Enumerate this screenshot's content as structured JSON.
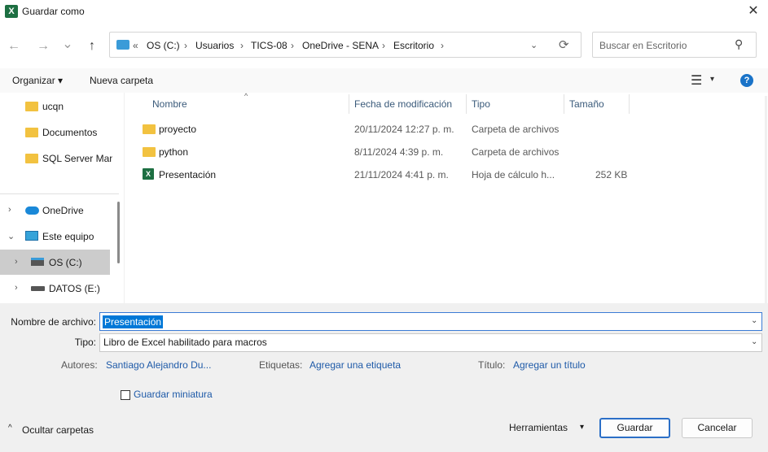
{
  "window": {
    "title": "Guardar como",
    "app_icon": "X",
    "close_glyph": "✕"
  },
  "nav": {
    "back": "←",
    "forward": "→",
    "recent": "⌄",
    "up": "↑",
    "prefix": "«",
    "breadcrumb": [
      "OS (C:)",
      "Usuarios",
      "TICS-08",
      "OneDrive - SENA",
      "Escritorio"
    ],
    "sep": "›",
    "dropdown": "⌄",
    "refresh": "⟳",
    "search_placeholder": "Buscar en Escritorio",
    "search_glyph": "⚲"
  },
  "commands": {
    "organize": "Organizar ▾",
    "new_folder": "Nueva carpeta",
    "view_glyph": "☰",
    "view_caret": "▾",
    "help": "?"
  },
  "tree": {
    "items": [
      {
        "label": "ucqn"
      },
      {
        "label": "Documentos"
      },
      {
        "label": "SQL Server Man"
      },
      {
        "label": "OneDrive"
      },
      {
        "label": "Este equipo"
      },
      {
        "label": "OS (C:)"
      },
      {
        "label": "DATOS (E:)"
      }
    ]
  },
  "columns": {
    "name": "Nombre",
    "modified": "Fecha de modificación",
    "type": "Tipo",
    "size": "Tamaño",
    "sort_glyph": "^"
  },
  "files": [
    {
      "name": "proyecto",
      "modified": "20/11/2024 12:27 p. m.",
      "type": "Carpeta de archivos",
      "size": ""
    },
    {
      "name": "python",
      "modified": "8/11/2024 4:39 p. m.",
      "type": "Carpeta de archivos",
      "size": ""
    },
    {
      "name": "Presentación",
      "modified": "21/11/2024 4:41 p. m.",
      "type": "Hoja de cálculo h...",
      "size": "252 KB"
    }
  ],
  "form": {
    "filename_label": "Nombre de archivo:",
    "filename_value": "Presentación",
    "type_label": "Tipo:",
    "type_value": "Libro de Excel habilitado para macros",
    "authors_label": "Autores:",
    "authors_value": "Santiago Alejandro Du...",
    "tags_label": "Etiquetas:",
    "tags_value": "Agregar una etiqueta",
    "title_label": "Título:",
    "title_value": "Agregar un título",
    "thumbnail_label": "Guardar miniatura",
    "thumbnail_checked": false
  },
  "footer": {
    "hide_folders": "Ocultar carpetas",
    "hide_glyph": "^",
    "tools": "Herramientas",
    "tools_caret": "▾",
    "save": "Guardar",
    "cancel": "Cancelar"
  }
}
